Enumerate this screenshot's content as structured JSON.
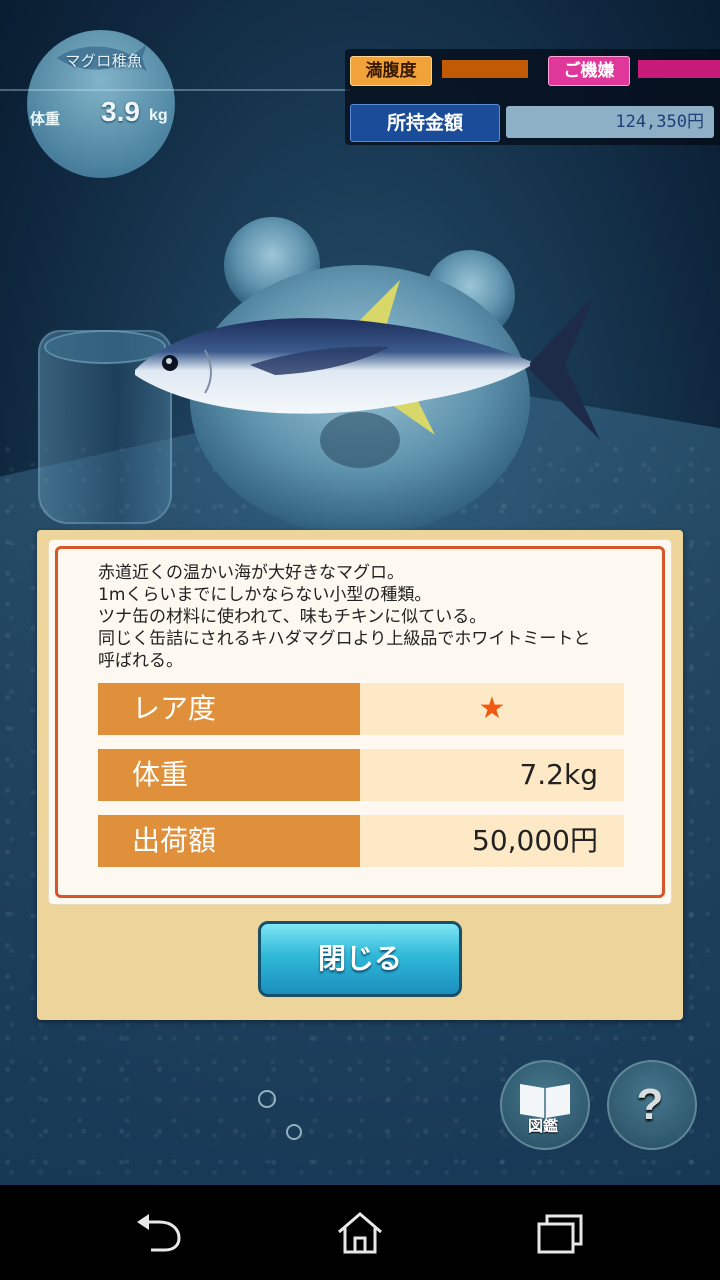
{
  "hud": {
    "fish_name": "マグロ稚魚",
    "weight_label": "体重",
    "weight_value": "3.9",
    "weight_unit": "kg",
    "hunger_label": "満腹度",
    "mood_label": "ご機嫌",
    "money_label": "所持金額",
    "money_value": "124,350円",
    "hunger_color": "#c05a06",
    "mood_color": "#c81a78"
  },
  "dialog": {
    "description": "赤道近くの温かい海が大好きなマグロ。\n1mくらいまでにしかならない小型の種類。\nツナ缶の材料に使われて、味もチキンに似ている。\n同じく缶詰にされるキハダマグロより上級品でホワイトミートと\n呼ばれる。",
    "rows": [
      {
        "label": "レア度",
        "value": "★"
      },
      {
        "label": "体重",
        "value": "7.2kg"
      },
      {
        "label": "出荷額",
        "value": "50,000円"
      }
    ],
    "close_label": "閉じる"
  },
  "buttons": {
    "book_label": "図鑑",
    "help_label": "?"
  }
}
